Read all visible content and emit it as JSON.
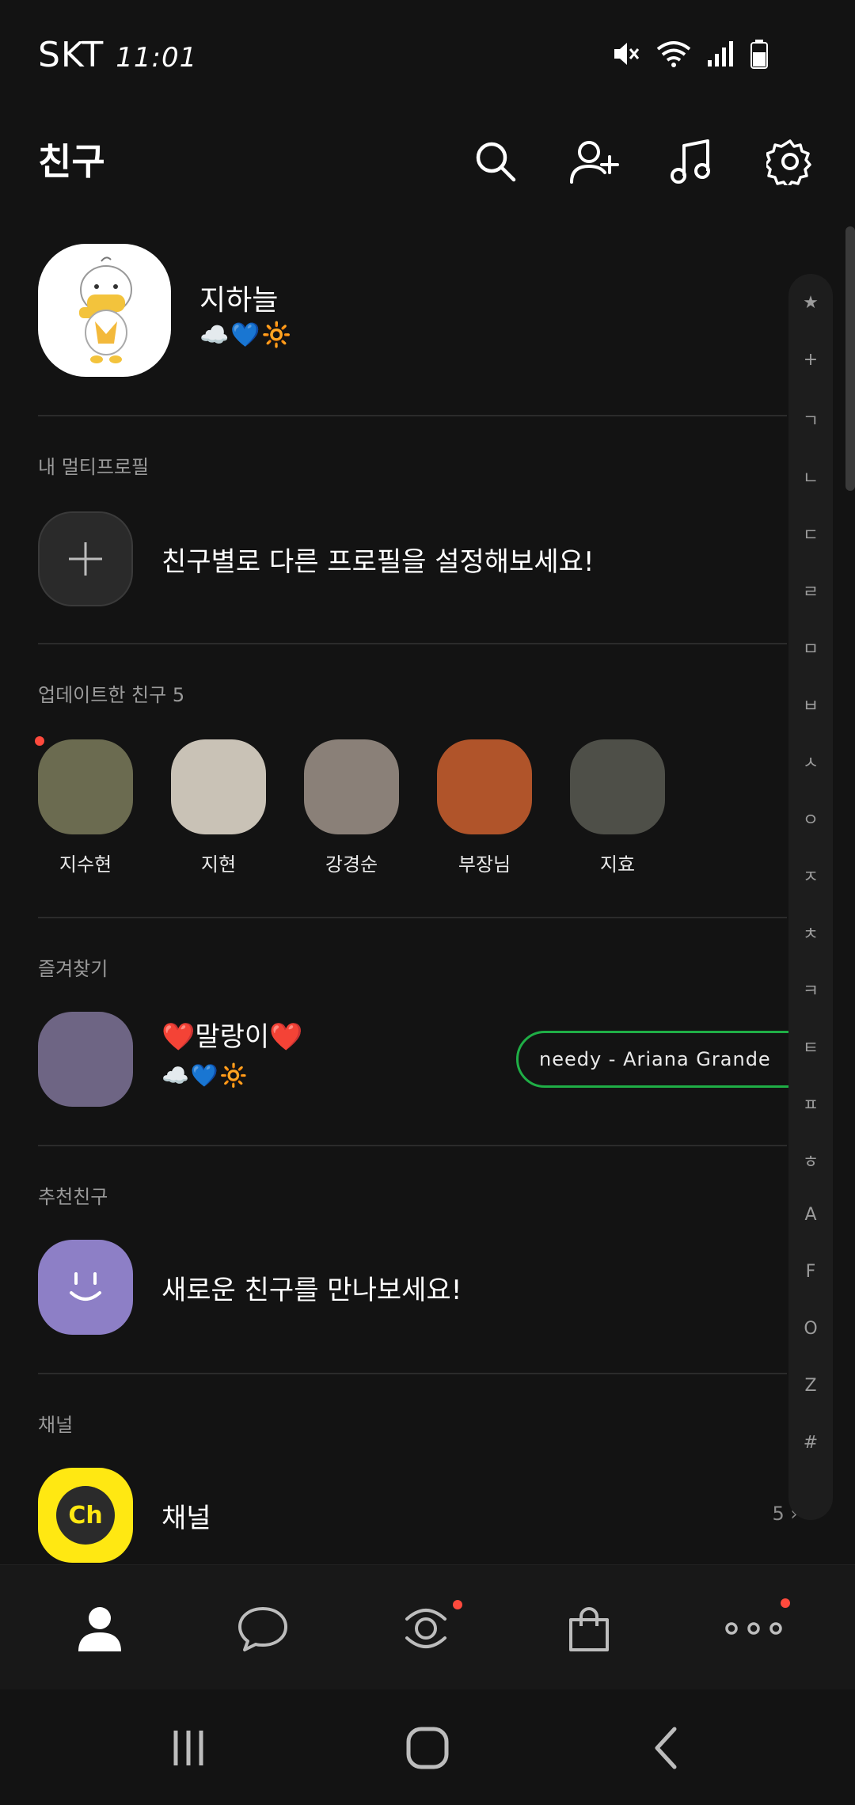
{
  "status_bar": {
    "carrier": "SKT",
    "time": "11:01"
  },
  "header": {
    "title": "친구"
  },
  "my_profile": {
    "name": "지하늘",
    "status": "☁️💙🔆"
  },
  "multi_profile": {
    "section_label": "내 멀티프로필",
    "prompt": "친구별로 다른 프로필을 설정해보세요!"
  },
  "updated_friends": {
    "section_label": "업데이트한 친구 5",
    "friends": [
      {
        "name": "지수현",
        "color": "#6b6b50",
        "new": true
      },
      {
        "name": "지현",
        "color": "#c9c2b6",
        "new": false
      },
      {
        "name": "강경순",
        "color": "#8a8078",
        "new": false
      },
      {
        "name": "부장님",
        "color": "#b0542a",
        "new": false
      },
      {
        "name": "지효",
        "color": "#4e4f48",
        "new": false
      }
    ]
  },
  "favorites": {
    "section_label": "즐겨찾기",
    "items": [
      {
        "name": "❤️말랑이❤️",
        "status": "☁️💙🔆",
        "music": "needy - Ariana Grande"
      }
    ]
  },
  "recommended": {
    "section_label": "추천친구",
    "prompt": "새로운 친구를 만나보세요!"
  },
  "channel": {
    "section_label": "채널",
    "label": "채널",
    "count": "5",
    "logo_text": "Ch"
  },
  "index_bar": [
    "★",
    "+",
    "ㄱ",
    "ㄴ",
    "ㄷ",
    "ㄹ",
    "ㅁ",
    "ㅂ",
    "ㅅ",
    "ㅇ",
    "ㅈ",
    "ㅊ",
    "ㅋ",
    "ㅌ",
    "ㅍ",
    "ㅎ",
    "A",
    "F",
    "O",
    "Z",
    "#"
  ],
  "colors": {
    "background": "#131313",
    "accent_green": "#1fae46",
    "badge_red": "#ff4a3d",
    "channel_yellow": "#ffe812",
    "recommend_purple": "#8d7fc6"
  }
}
